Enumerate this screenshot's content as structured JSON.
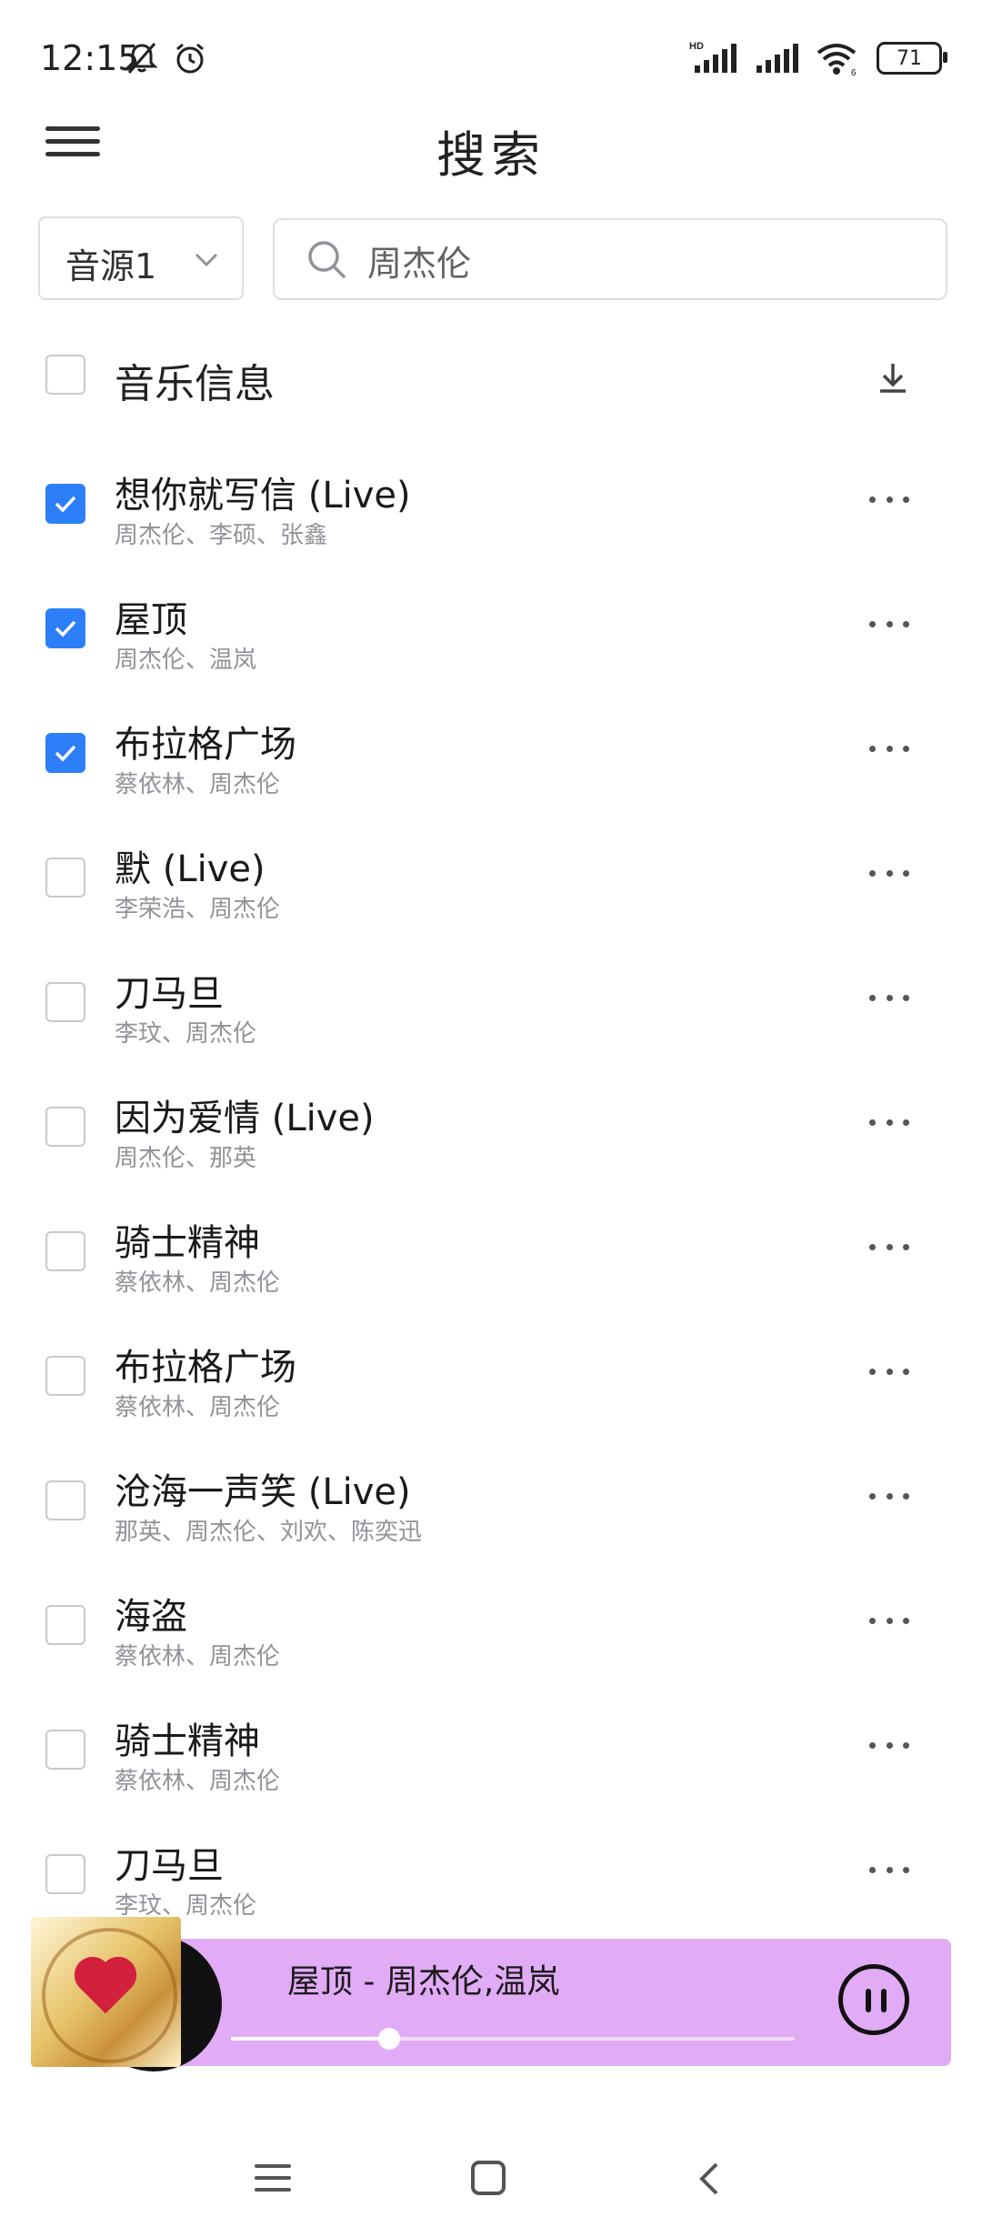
{
  "status_bar": {
    "time": "12:15",
    "battery": "71",
    "network_badge": "HD",
    "wifi_badge": "6"
  },
  "header": {
    "title": "搜索"
  },
  "search": {
    "source_label": "音源1",
    "query": "周杰伦"
  },
  "list": {
    "header_label": "音乐信息",
    "accent_color": "#2d7ff9",
    "songs": [
      {
        "name": "想你就写信 (Live)",
        "artists": "周杰伦、李硕、张鑫",
        "checked": true
      },
      {
        "name": "屋顶",
        "artists": "周杰伦、温岚",
        "checked": true
      },
      {
        "name": "布拉格广场",
        "artists": "蔡依林、周杰伦",
        "checked": true
      },
      {
        "name": "默 (Live)",
        "artists": "李荣浩、周杰伦",
        "checked": false
      },
      {
        "name": "刀马旦",
        "artists": "李玟、周杰伦",
        "checked": false
      },
      {
        "name": "因为爱情 (Live)",
        "artists": "周杰伦、那英",
        "checked": false
      },
      {
        "name": "骑士精神",
        "artists": "蔡依林、周杰伦",
        "checked": false
      },
      {
        "name": "布拉格广场",
        "artists": "蔡依林、周杰伦",
        "checked": false
      },
      {
        "name": "沧海一声笑 (Live)",
        "artists": "那英、周杰伦、刘欢、陈奕迅",
        "checked": false
      },
      {
        "name": "海盗",
        "artists": "蔡依林、周杰伦",
        "checked": false
      },
      {
        "name": "骑士精神",
        "artists": "蔡依林、周杰伦",
        "checked": false
      },
      {
        "name": "刀马旦",
        "artists": "李玟、周杰伦",
        "checked": false
      }
    ]
  },
  "player": {
    "now_playing": "屋顶 - 周杰伦,温岚",
    "progress": 0.28,
    "background_color": "#e2abf6",
    "state": "playing"
  }
}
